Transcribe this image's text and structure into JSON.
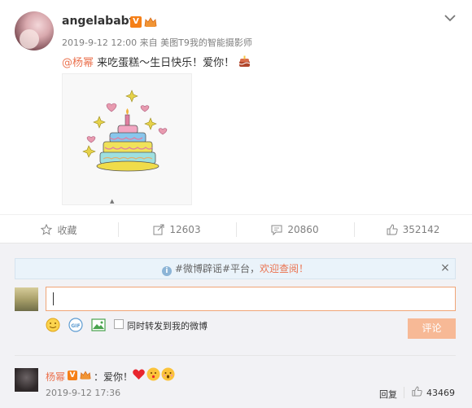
{
  "post": {
    "username": "angelababy",
    "badge_v": "V",
    "badge_vip": "👑",
    "timestamp": "2019-9-12 12:00",
    "source_prefix": "来自",
    "source_name": "美图T9我的智能摄影师",
    "mention": "@杨幂",
    "text": " 来吃蛋糕～生日快乐！爱你！",
    "emoji_icon": "birthday-cake-icon"
  },
  "actions": {
    "favorite_label": "收藏",
    "repost_count": "12603",
    "comment_count": "20860",
    "like_count": "352142"
  },
  "comment_box": {
    "notice_prefix": "#微博辟谣#平台，",
    "notice_link": "欢迎查阅！",
    "close_label": "×",
    "input_value": "",
    "repost_checkbox_label": "同时转发到我的微博",
    "submit_label": "评论"
  },
  "comments": [
    {
      "user": "杨幂",
      "badge_v": "V",
      "badge_vip": "👑",
      "text": "：爱你！",
      "time": "2019-9-12 17:36",
      "reply_label": "回复",
      "like_count": "43469"
    }
  ],
  "colors": {
    "accent": "#eb7350",
    "link": "#eb7350",
    "button": "#f7b996"
  }
}
